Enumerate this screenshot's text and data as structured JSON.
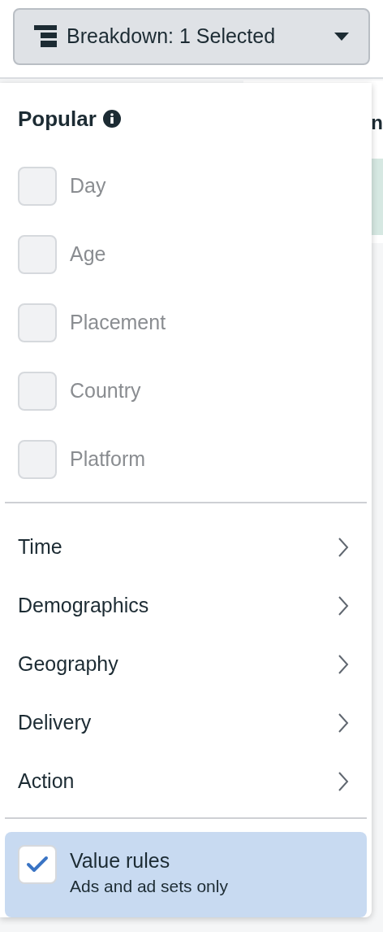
{
  "breakdown_button": {
    "label": "Breakdown: 1 Selected"
  },
  "background": {
    "column_header": "n"
  },
  "menu": {
    "popular": {
      "title": "Popular",
      "items": [
        {
          "label": "Day",
          "checked": false,
          "disabled": true
        },
        {
          "label": "Age",
          "checked": false,
          "disabled": true
        },
        {
          "label": "Placement",
          "checked": false,
          "disabled": true
        },
        {
          "label": "Country",
          "checked": false,
          "disabled": true
        },
        {
          "label": "Platform",
          "checked": false,
          "disabled": true
        }
      ]
    },
    "categories": [
      {
        "label": "Time"
      },
      {
        "label": "Demographics"
      },
      {
        "label": "Geography"
      },
      {
        "label": "Delivery"
      },
      {
        "label": "Action"
      }
    ],
    "value_rules": {
      "label": "Value rules",
      "description": "Ads and ad sets only",
      "checked": true,
      "selected": true
    }
  }
}
